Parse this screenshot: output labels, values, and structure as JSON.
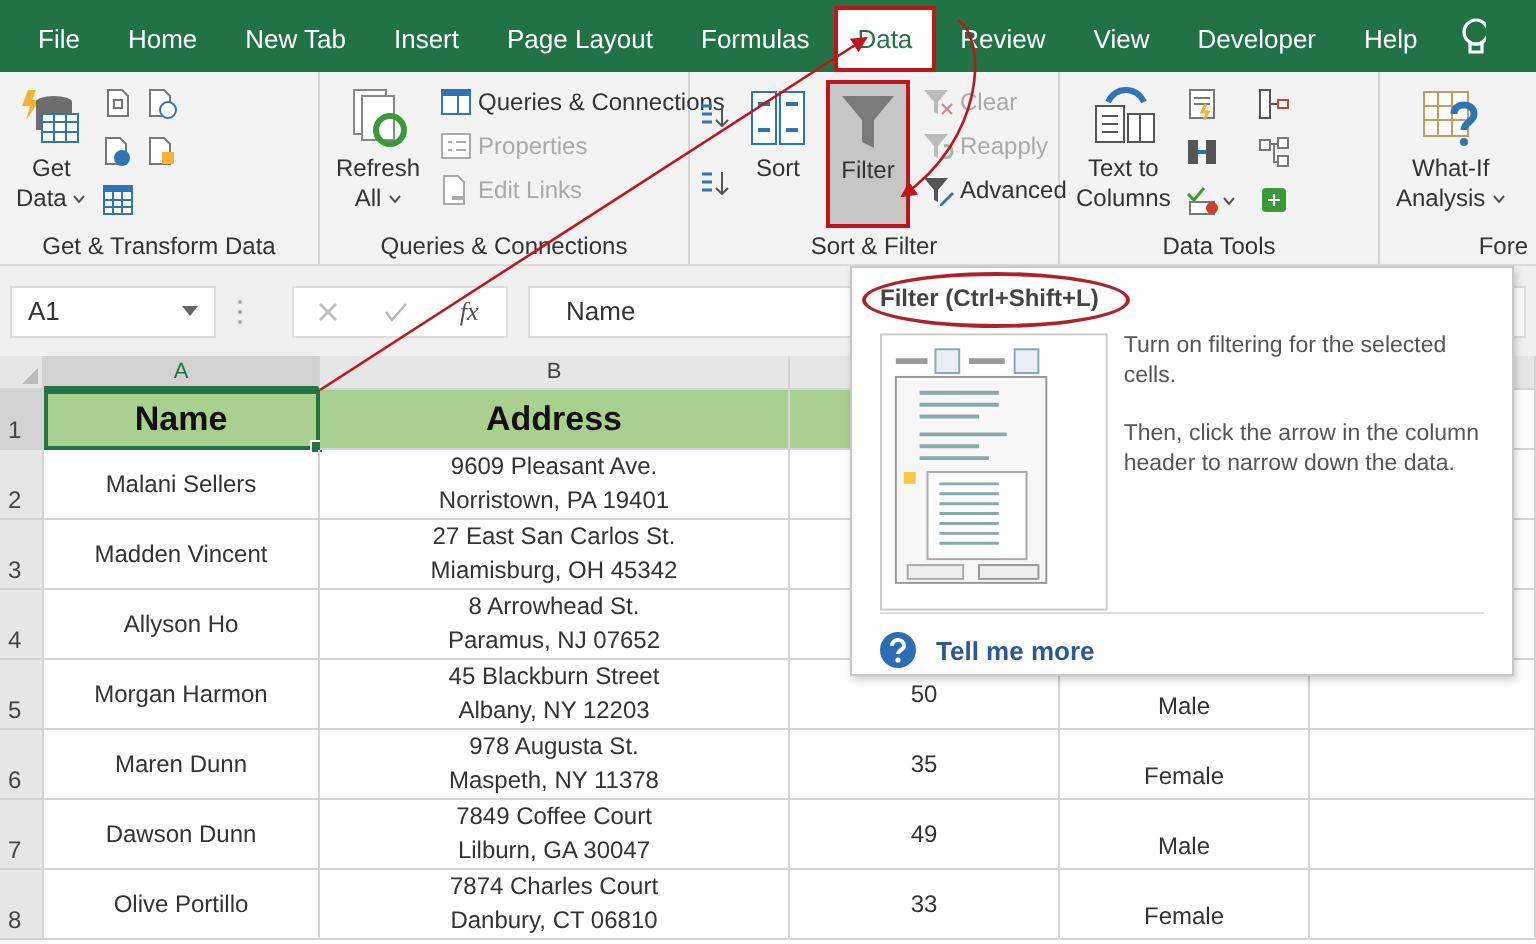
{
  "menu_tabs": [
    {
      "label": "File",
      "selected": false
    },
    {
      "label": "Home",
      "selected": false
    },
    {
      "label": "New Tab",
      "selected": false
    },
    {
      "label": "Insert",
      "selected": false
    },
    {
      "label": "Page Layout",
      "selected": false
    },
    {
      "label": "Formulas",
      "selected": false
    },
    {
      "label": "Data",
      "selected": true
    },
    {
      "label": "Review",
      "selected": false
    },
    {
      "label": "View",
      "selected": false
    },
    {
      "label": "Developer",
      "selected": false
    },
    {
      "label": "Help",
      "selected": false
    }
  ],
  "ribbon_groups": [
    {
      "kind": "get-data",
      "title": "Get & Transform Data",
      "buttons": [
        {
          "label": "Get\nData",
          "dropdown": true,
          "pressed": false,
          "disabled": false
        }
      ]
    },
    {
      "kind": "queries",
      "title": "Queries & Connections",
      "buttons": [
        {
          "label": "Refresh\nAll",
          "dropdown": true,
          "pressed": false,
          "disabled": false
        }
      ],
      "commands": [
        {
          "label": "Queries & Connections",
          "disabled": false
        },
        {
          "label": "Properties",
          "disabled": true
        },
        {
          "label": "Edit Links",
          "disabled": true
        }
      ]
    },
    {
      "kind": "sort-filter",
      "title": "Sort & Filter",
      "buttons": [
        {
          "label": "Sort",
          "dropdown": false,
          "pressed": false,
          "disabled": false
        },
        {
          "label": "Filter",
          "dropdown": false,
          "pressed": true,
          "disabled": false
        }
      ],
      "commands": [
        {
          "label": "Clear",
          "disabled": true
        },
        {
          "label": "Reapply",
          "disabled": true
        },
        {
          "label": "Advanced",
          "disabled": false
        }
      ]
    },
    {
      "kind": "data-tools",
      "title": "Data Tools",
      "buttons": [
        {
          "label": "Text to\nColumns",
          "dropdown": false,
          "pressed": false,
          "disabled": false
        }
      ]
    },
    {
      "kind": "what-if",
      "title": "Fore",
      "buttons": [
        {
          "label": "What-If\nAnalysis",
          "dropdown": true,
          "pressed": false,
          "disabled": false
        }
      ]
    }
  ],
  "formula_bar": {
    "name_box": "A1",
    "function_button": "fx",
    "value": "Name"
  },
  "columns": [
    {
      "label": "A",
      "selected": true
    },
    {
      "label": "B",
      "selected": false
    }
  ],
  "rows": [
    {
      "number": "1",
      "selected": true,
      "kind": "header",
      "cells": [
        "Name",
        "Address"
      ]
    },
    {
      "number": "2",
      "selected": false,
      "kind": "data",
      "cells": [
        "Malani Sellers",
        "9609 Pleasant Ave.\nNorristown, PA 19401"
      ]
    },
    {
      "number": "3",
      "selected": false,
      "kind": "data",
      "cells": [
        "Madden Vincent",
        "27 East San Carlos St.\nMiamisburg, OH 45342"
      ]
    },
    {
      "number": "4",
      "selected": false,
      "kind": "data",
      "cells": [
        "Allyson Ho",
        "8 Arrowhead St.\nParamus, NJ 07652"
      ]
    },
    {
      "number": "5",
      "selected": false,
      "kind": "data",
      "cells": [
        "Morgan Harmon",
        "45 Blackburn Street\nAlbany, NY 12203",
        "50",
        "Male"
      ]
    },
    {
      "number": "6",
      "selected": false,
      "kind": "data",
      "cells": [
        "Maren Dunn",
        "978 Augusta St.\nMaspeth, NY 11378",
        "35",
        "Female"
      ]
    },
    {
      "number": "7",
      "selected": false,
      "kind": "data",
      "cells": [
        "Dawson Dunn",
        "7849 Coffee Court\nLilburn, GA 30047",
        "49",
        "Male"
      ]
    },
    {
      "number": "8",
      "selected": false,
      "kind": "data",
      "cells": [
        "Olive Portillo",
        "7874 Charles Court\nDanbury, CT 06810",
        "33",
        "Female"
      ]
    }
  ],
  "tooltip": {
    "title": "Filter (Ctrl+Shift+L)",
    "paragraphs": [
      "Turn on filtering for the selected cells.",
      "Then, click the arrow in the column header to narrow down the data."
    ],
    "link": "Tell me more"
  }
}
